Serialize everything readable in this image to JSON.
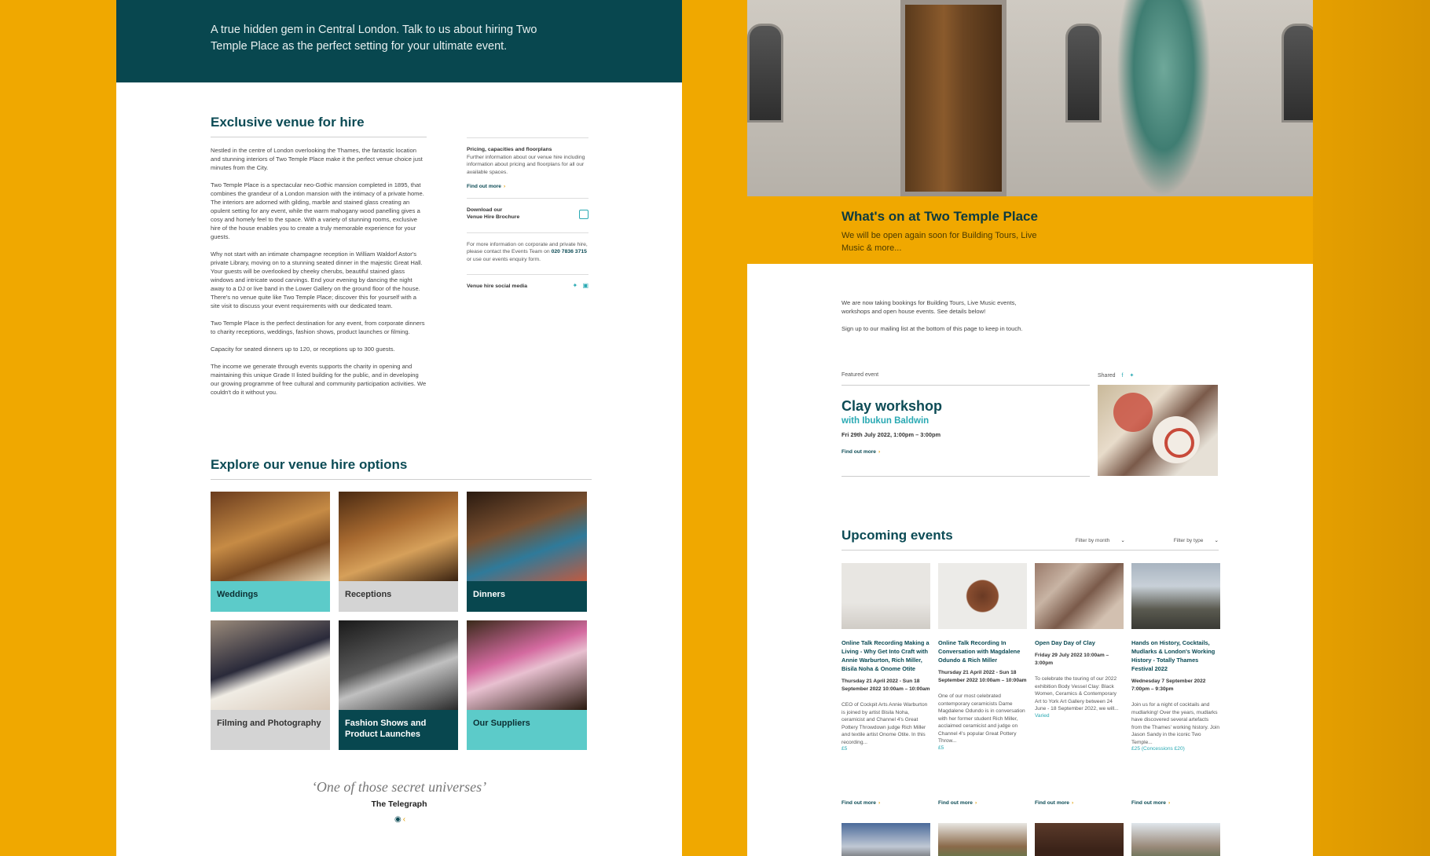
{
  "left": {
    "hero_text": "A true hidden gem in Central London. Talk to us about hiring Two Temple Place as the perfect setting for your ultimate event.",
    "section_title": "Exclusive venue for hire",
    "paragraphs": [
      "Nestled in the centre of London overlooking the Thames, the fantastic location and stunning interiors of Two Temple Place make it the perfect venue choice just minutes from the City.",
      "Two Temple Place is a spectacular neo-Gothic mansion completed in 1895, that combines the grandeur of a London mansion with the intimacy of a private home. The interiors are adorned with gilding, marble and stained glass creating an opulent setting for any event, while the warm mahogany wood panelling gives a cosy and homely feel to the space. With a variety of stunning rooms, exclusive hire of the house enables you to create a truly memorable experience for your guests.",
      "Why not start with an intimate champagne reception in William Waldorf Astor's private Library, moving on to a stunning seated dinner in the majestic Great Hall. Your guests will be overlooked by cheeky cherubs, beautiful stained glass windows and intricate wood carvings. End your evening by dancing the night away to a DJ or live band in the Lower Gallery on the ground floor of the house. There's no venue quite like Two Temple Place; discover this for yourself with a site visit to discuss your event requirements with our dedicated team.",
      "Two Temple Place is the perfect destination for any event, from corporate dinners to charity receptions, weddings, fashion shows, product launches or filming.",
      "Capacity for seated dinners up to 120, or receptions up to 300 guests.",
      "The income we generate through events supports the charity in opening and maintaining this unique Grade II listed building for the public, and in developing our growing programme of free cultural and community participation activities. We couldn't do it without you."
    ],
    "sidebar": {
      "pricing_heading": "Pricing, capacities and floorplans",
      "pricing_text": "Further information about our venue hire including information about pricing and floorplans for all our available spaces.",
      "find_out_more": "Find out more",
      "download_line1": "Download our",
      "download_line2": "Venue Hire Brochure",
      "contact_text_1": "For more information on corporate and private hire, please contact the Events Team on",
      "contact_phone": "020 7836 3715",
      "contact_text_2": "or use our events enquiry form.",
      "social_label": "Venue hire social media"
    },
    "explore_title": "Explore our venue hire options",
    "tiles": [
      {
        "label": "Weddings",
        "cap_bg": "#5ccbc9",
        "cap_fg": "#0c2f33",
        "img": "linear-gradient(160deg,#6a3b1d,#c68b45 45%,#7a4a22 70%,#e6d2b0)"
      },
      {
        "label": "Receptions",
        "cap_bg": "#d4d4d4",
        "cap_fg": "#333333",
        "img": "linear-gradient(160deg,#4a2a12,#a86a30 40%,#d6a05a 65%,#3a2210)"
      },
      {
        "label": "Dinners",
        "cap_bg": "#08474f",
        "cap_fg": "#ffffff",
        "img": "linear-gradient(160deg,#2a1a10,#7a5030 40%,#2f7a9a 65%,#c05a40)"
      },
      {
        "label": "Filming and Photography",
        "cap_bg": "#d4d4d4",
        "cap_fg": "#333333",
        "img": "linear-gradient(160deg,#9a8a7a,#2a2a3a 45%,#f0ece4 60%,#d8c8b8)"
      },
      {
        "label": "Fashion Shows and Product Launches",
        "cap_bg": "#08474f",
        "cap_fg": "#ffffff",
        "img": "linear-gradient(160deg,#1a1a1a,#5a5a5a 45%,#c0c0c0 60%,#2a2a2a)"
      },
      {
        "label": "Our Suppliers",
        "cap_bg": "#5ccbc9",
        "cap_fg": "#0c2f33",
        "img": "linear-gradient(160deg,#3a2a1a,#d46aa0 40%,#e8c0d0 55%,#2a1a10)"
      }
    ],
    "quote": "‘One of those secret universes’",
    "quote_source": "The Telegraph"
  },
  "right": {
    "whats_on_title": "What's on at Two Temple Place",
    "whats_on_sub": "We will be open again soon for Building Tours, Live Music & more...",
    "notice_1": "We are now taking bookings for Building Tours, Live Music events, workshops and open house events. See details below!",
    "notice_2": "Sign up to our mailing list at the bottom of this page to keep in touch.",
    "featured_label": "Featured event",
    "shared_label": "Shared",
    "featured_title": "Clay workshop",
    "featured_sub": "with Ibukun Baldwin",
    "featured_date": "Fri 29th July 2022, 1:00pm – 3:00pm",
    "find_out_more": "Find out more",
    "upcoming_title": "Upcoming events",
    "filter_month": "Filter by month",
    "filter_type": "Filter by type",
    "events": [
      {
        "title": "Online Talk Recording Making a Living - Why Get Into Craft with Annie Warburton, Rich Miller, Bisila Noha & Onome Otite",
        "date": "Thursday 21 April 2022 - Sun 18 September 2022 10:00am – 10:00am",
        "desc": "CEO of Cockpit Arts Annie Warburton is joined by artist Bisila Noha, ceramicist and Channel 4's Great Pottery Throwdown judge Rich Miller and textile artist Onome Otite. In this recording...",
        "price": "£5",
        "img": "linear-gradient(180deg,#e8e6e2 60%,#d0ccc6)"
      },
      {
        "title": "Online Talk Recording In Conversation with Magdalene Odundo & Rich Miller",
        "date": "Thursday 21 April 2022 - Sun 18 September 2022 10:00am – 10:00am",
        "desc": "One of our most celebrated contemporary ceramicists Dame Magdalene Odundo is in conversation with her former student Rich Miller, acclaimed ceramicist and judge on Channel 4's popular Great Pottery Throw...",
        "price": "£5",
        "img": "radial-gradient(circle at 50% 50%,#6a3a24 0%,#8a4e30 28%,#ecebe8 30%)"
      },
      {
        "title": "Open Day Day of Clay",
        "date": "Friday 29 July 2022 10:00am – 3:00pm",
        "desc": "To celebrate the touring of our 2022 exhibition Body Vessel Clay: Black Women, Ceramics & Contemporary Art to York Art Gallery between 24 June - 18 September 2022, we will...",
        "price": "Varied",
        "img": "linear-gradient(135deg,#9a7a6a,#c8b4a4 30%,#7a5a4a 55%,#d2c0b0 80%)"
      },
      {
        "title": "Hands on History, Cocktails, Mudlarks & London's Working History - Totally Thames Festival 2022",
        "date": "Wednesday 7 September 2022 7:00pm – 9:30pm",
        "desc": "Join us for a night of cocktails and mudlarking! Over the years, mudlarks have discovered several artefacts from the Thames' working history. Join Jason Sandy in the iconic Two Temple...",
        "price": "£25 (Concessions £20)",
        "img": "linear-gradient(180deg,#a8b4c0 0%,#c8d0d8 35%,#5a5a50 70%,#3a3a34)"
      }
    ],
    "thumbs": [
      "linear-gradient(180deg,#4a6a9a,#c0c8d4 60%,#5a5a5a)",
      "linear-gradient(180deg,#e8e6e2,#8a6a4a 60%,#5a7a4a)",
      "linear-gradient(180deg,#5a3a2a,#3a2218 70%)",
      "linear-gradient(180deg,#dfe6ec,#9a8a7a 60%,#5a6a4a)"
    ]
  }
}
